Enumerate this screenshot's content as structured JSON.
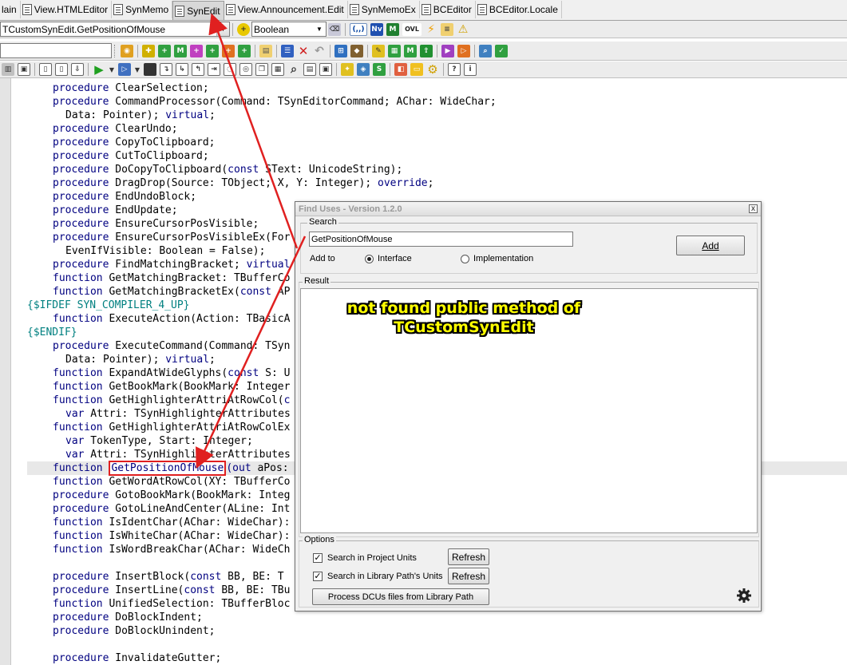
{
  "tabs": [
    {
      "label": "lain",
      "active": false
    },
    {
      "label": "View.HTMLEditor",
      "active": false
    },
    {
      "label": "SynMemo",
      "active": false
    },
    {
      "label": "SynEdit",
      "active": true
    },
    {
      "label": "View.Announcement.Edit",
      "active": false
    },
    {
      "label": "SynMemoEx",
      "active": false
    },
    {
      "label": "BCEditor",
      "active": false
    },
    {
      "label": "BCEditor.Locale",
      "active": false
    }
  ],
  "toolbar1": {
    "symbol_combo": "TCustomSynEdit.GetPositionOfMouse",
    "type_combo": "Boolean",
    "icons": [
      "plus-yellow-icon",
      "eraser-icon",
      "paren-icon",
      "nv-icon",
      "m-icon",
      "ovl-icon",
      "lightning-icon",
      "list-icon",
      "warning-icon"
    ],
    "icon_labels": {
      "paren": "(,,)",
      "nv": "Nv",
      "m": "M",
      "ovl": "OVL"
    }
  },
  "toolbar2": {
    "search_value": ""
  },
  "code_lines": [
    {
      "indent": 2,
      "parts": [
        [
          "kw",
          "procedure"
        ],
        [
          "t",
          " ClearSelection;"
        ]
      ]
    },
    {
      "indent": 2,
      "parts": [
        [
          "kw",
          "procedure"
        ],
        [
          "t",
          " CommandProcessor(Command: TSynEditorCommand; AChar: WideChar;"
        ]
      ]
    },
    {
      "indent": 3,
      "parts": [
        [
          "t",
          "Data: Pointer); "
        ],
        [
          "kw",
          "virtual"
        ],
        [
          "t",
          ";"
        ]
      ]
    },
    {
      "indent": 2,
      "parts": [
        [
          "kw",
          "procedure"
        ],
        [
          "t",
          " ClearUndo;"
        ]
      ]
    },
    {
      "indent": 2,
      "parts": [
        [
          "kw",
          "procedure"
        ],
        [
          "t",
          " CopyToClipboard;"
        ]
      ]
    },
    {
      "indent": 2,
      "parts": [
        [
          "kw",
          "procedure"
        ],
        [
          "t",
          " CutToClipboard;"
        ]
      ]
    },
    {
      "indent": 2,
      "parts": [
        [
          "kw",
          "procedure"
        ],
        [
          "t",
          " DoCopyToClipboard("
        ],
        [
          "kw",
          "const"
        ],
        [
          "t",
          " SText: UnicodeString);"
        ]
      ]
    },
    {
      "indent": 2,
      "parts": [
        [
          "kw",
          "procedure"
        ],
        [
          "t",
          " DragDrop(Source: TObject; X, Y: Integer); "
        ],
        [
          "kw",
          "override"
        ],
        [
          "t",
          ";"
        ]
      ]
    },
    {
      "indent": 2,
      "parts": [
        [
          "kw",
          "procedure"
        ],
        [
          "t",
          " EndUndoBlock;"
        ]
      ]
    },
    {
      "indent": 2,
      "parts": [
        [
          "kw",
          "procedure"
        ],
        [
          "t",
          " EndUpdate;"
        ]
      ]
    },
    {
      "indent": 2,
      "parts": [
        [
          "kw",
          "procedure"
        ],
        [
          "t",
          " EnsureCursorPosVisible;"
        ]
      ]
    },
    {
      "indent": 2,
      "parts": [
        [
          "kw",
          "procedure"
        ],
        [
          "t",
          " EnsureCursorPosVisibleEx(For"
        ]
      ]
    },
    {
      "indent": 3,
      "parts": [
        [
          "t",
          "EvenIfVisible: Boolean = False);"
        ]
      ]
    },
    {
      "indent": 2,
      "parts": [
        [
          "kw",
          "procedure"
        ],
        [
          "t",
          " FindMatchingBracket; "
        ],
        [
          "kw",
          "virtual"
        ]
      ]
    },
    {
      "indent": 2,
      "parts": [
        [
          "kw",
          "function"
        ],
        [
          "t",
          " GetMatchingBracket: TBufferCo"
        ]
      ]
    },
    {
      "indent": 2,
      "parts": [
        [
          "kw",
          "function"
        ],
        [
          "t",
          " GetMatchingBracketEx("
        ],
        [
          "kw",
          "const"
        ],
        [
          "t",
          " AP"
        ]
      ]
    },
    {
      "indent": 0,
      "parts": [
        [
          "dir",
          "{$IFDEF SYN_COMPILER_4_UP}"
        ]
      ]
    },
    {
      "indent": 2,
      "parts": [
        [
          "kw",
          "function"
        ],
        [
          "t",
          " ExecuteAction(Action: TBasicA"
        ]
      ]
    },
    {
      "indent": 0,
      "parts": [
        [
          "dir",
          "{$ENDIF}"
        ]
      ]
    },
    {
      "indent": 2,
      "parts": [
        [
          "kw",
          "procedure"
        ],
        [
          "t",
          " ExecuteCommand(Command: TSyn"
        ]
      ]
    },
    {
      "indent": 3,
      "parts": [
        [
          "t",
          "Data: Pointer); "
        ],
        [
          "kw",
          "virtual"
        ],
        [
          "t",
          ";"
        ]
      ]
    },
    {
      "indent": 2,
      "parts": [
        [
          "kw",
          "function"
        ],
        [
          "t",
          " ExpandAtWideGlyphs("
        ],
        [
          "kw",
          "const"
        ],
        [
          "t",
          " S: U"
        ]
      ]
    },
    {
      "indent": 2,
      "parts": [
        [
          "kw",
          "function"
        ],
        [
          "t",
          " GetBookMark(BookMark: Integer"
        ]
      ]
    },
    {
      "indent": 2,
      "parts": [
        [
          "kw",
          "function"
        ],
        [
          "t",
          " GetHighlighterAttriAtRowCol("
        ],
        [
          "kw",
          "c"
        ]
      ]
    },
    {
      "indent": 3,
      "parts": [
        [
          "kw",
          "var"
        ],
        [
          "t",
          " Attri: TSynHighlighterAttributes"
        ]
      ]
    },
    {
      "indent": 2,
      "parts": [
        [
          "kw",
          "function"
        ],
        [
          "t",
          " GetHighlighterAttriAtRowColEx"
        ]
      ]
    },
    {
      "indent": 3,
      "parts": [
        [
          "kw",
          "var"
        ],
        [
          "t",
          " TokenType, Start: Integer;"
        ]
      ]
    },
    {
      "indent": 3,
      "parts": [
        [
          "kw",
          "var"
        ],
        [
          "t",
          " Attri: TSynHighlighterAttributes"
        ]
      ]
    },
    {
      "indent": 2,
      "current": true,
      "parts": [
        [
          "kw",
          "function"
        ],
        [
          "t",
          " "
        ],
        [
          "hl",
          "GetPositionOfMouse"
        ],
        [
          "kw",
          "(out"
        ],
        [
          "t",
          " aPos:"
        ]
      ]
    },
    {
      "indent": 2,
      "parts": [
        [
          "kw",
          "function"
        ],
        [
          "t",
          " GetWordAtRowCol(XY: TBufferCo"
        ]
      ]
    },
    {
      "indent": 2,
      "parts": [
        [
          "kw",
          "procedure"
        ],
        [
          "t",
          " GotoBookMark(BookMark: Integ"
        ]
      ]
    },
    {
      "indent": 2,
      "parts": [
        [
          "kw",
          "procedure"
        ],
        [
          "t",
          " GotoLineAndCenter(ALine: Int"
        ]
      ]
    },
    {
      "indent": 2,
      "parts": [
        [
          "kw",
          "function"
        ],
        [
          "t",
          " IsIdentChar(AChar: WideChar):"
        ]
      ]
    },
    {
      "indent": 2,
      "parts": [
        [
          "kw",
          "function"
        ],
        [
          "t",
          " IsWhiteChar(AChar: WideChar):"
        ]
      ]
    },
    {
      "indent": 2,
      "parts": [
        [
          "kw",
          "function"
        ],
        [
          "t",
          " IsWordBreakChar(AChar: WideCh"
        ]
      ]
    },
    {
      "indent": 0,
      "parts": [
        [
          "t",
          ""
        ]
      ]
    },
    {
      "indent": 2,
      "parts": [
        [
          "kw",
          "procedure"
        ],
        [
          "t",
          " InsertBlock("
        ],
        [
          "kw",
          "const"
        ],
        [
          "t",
          " BB, BE: T"
        ]
      ]
    },
    {
      "indent": 2,
      "parts": [
        [
          "kw",
          "procedure"
        ],
        [
          "t",
          " InsertLine("
        ],
        [
          "kw",
          "const"
        ],
        [
          "t",
          " BB, BE: TBu"
        ]
      ]
    },
    {
      "indent": 2,
      "parts": [
        [
          "kw",
          "function"
        ],
        [
          "t",
          " UnifiedSelection: TBufferBloc"
        ]
      ]
    },
    {
      "indent": 2,
      "parts": [
        [
          "kw",
          "procedure"
        ],
        [
          "t",
          " DoBlockIndent;"
        ]
      ]
    },
    {
      "indent": 2,
      "parts": [
        [
          "kw",
          "procedure"
        ],
        [
          "t",
          " DoBlockUnindent;"
        ]
      ]
    },
    {
      "indent": 0,
      "parts": [
        [
          "t",
          ""
        ]
      ]
    },
    {
      "indent": 2,
      "parts": [
        [
          "kw",
          "procedure"
        ],
        [
          "t",
          " InvalidateGutter;"
        ]
      ]
    }
  ],
  "dialog": {
    "title": "Find Uses - Version 1.2.0",
    "close_label": "x",
    "search_group_label": "Search",
    "search_value": "GetPositionOfMouse",
    "add_button": "Add",
    "add_to_label": "Add to",
    "radio_interface": "Interface",
    "radio_implementation": "Implementation",
    "selected_radio": "interface",
    "result_group_label": "Result",
    "annotation": "not found public method of TCustomSynEdit",
    "options_group_label": "Options",
    "check_project_units": "Search in Project Units",
    "check_library_units": "Search in Library Path's Units",
    "refresh_label": "Refresh",
    "process_dcu_button": "Process DCUs files from Library Path",
    "colors": {
      "annotation": "#ffff00",
      "arrow": "#e02020"
    }
  }
}
